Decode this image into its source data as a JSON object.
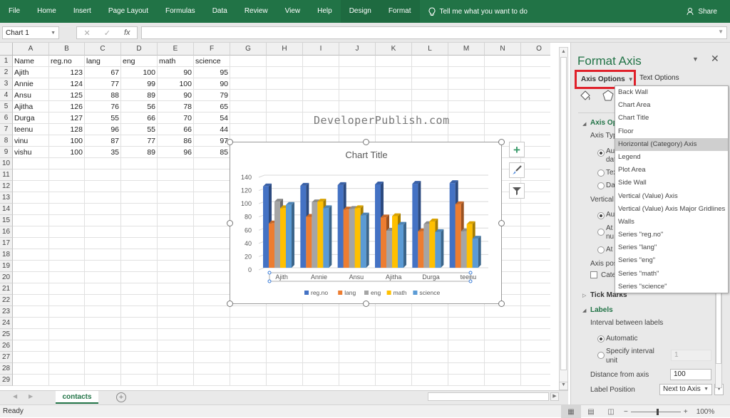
{
  "ribbon": {
    "tabs": [
      "File",
      "Home",
      "Insert",
      "Page Layout",
      "Formulas",
      "Data",
      "Review",
      "View",
      "Help",
      "Design",
      "Format"
    ],
    "tell_me": "Tell me what you want to do",
    "share": "Share",
    "icons": {
      "tell_me": "lightbulb-icon",
      "share": "person-add-icon"
    }
  },
  "formula_bar": {
    "name_box": "Chart 1",
    "cancel": "✕",
    "enter": "✓",
    "fx": "fx",
    "formula": ""
  },
  "sheet": {
    "columns": [
      "A",
      "B",
      "C",
      "D",
      "E",
      "F",
      "G",
      "H",
      "I",
      "J",
      "K",
      "L",
      "M",
      "N",
      "O"
    ],
    "row_numbers": [
      "1",
      "2",
      "3",
      "4",
      "5",
      "6",
      "7",
      "8",
      "9",
      "10",
      "11",
      "12",
      "13",
      "14",
      "15",
      "16",
      "17",
      "18",
      "19",
      "20",
      "21",
      "22",
      "23",
      "24",
      "25",
      "26",
      "27",
      "28",
      "29"
    ],
    "header_row": [
      "Name",
      "reg.no",
      "lang",
      "eng",
      "math",
      "science"
    ],
    "rows": [
      [
        "Ajith",
        "123",
        "67",
        "100",
        "90",
        "95"
      ],
      [
        "Annie",
        "124",
        "77",
        "99",
        "100",
        "90"
      ],
      [
        "Ansu",
        "125",
        "88",
        "89",
        "90",
        "79"
      ],
      [
        "Ajitha",
        "126",
        "76",
        "56",
        "78",
        "65"
      ],
      [
        "Durga",
        "127",
        "55",
        "66",
        "70",
        "54"
      ],
      [
        "teenu",
        "128",
        "96",
        "55",
        "66",
        "44"
      ],
      [
        "vinu",
        "100",
        "87",
        "77",
        "86",
        "97"
      ],
      [
        "vishu",
        "100",
        "35",
        "89",
        "96",
        "85"
      ]
    ],
    "watermark": "DeveloperPublish.com",
    "tab": "contacts",
    "add_sheet": "+"
  },
  "chart_data": {
    "type": "bar",
    "style": "3d-clustered-column",
    "title": "Chart Title",
    "categories": [
      "Ajith",
      "Annie",
      "Ansu",
      "Ajitha",
      "Durga",
      "teenu"
    ],
    "series": [
      {
        "name": "reg.no",
        "color": "#4472c4",
        "values": [
          123,
          124,
          125,
          126,
          127,
          128
        ]
      },
      {
        "name": "lang",
        "color": "#ed7d31",
        "values": [
          67,
          77,
          88,
          76,
          55,
          96
        ]
      },
      {
        "name": "eng",
        "color": "#a5a5a5",
        "values": [
          100,
          99,
          89,
          56,
          66,
          55
        ]
      },
      {
        "name": "math",
        "color": "#ffc000",
        "values": [
          90,
          100,
          90,
          78,
          70,
          66
        ]
      },
      {
        "name": "science",
        "color": "#5b9bd5",
        "values": [
          95,
          90,
          79,
          65,
          54,
          44
        ]
      }
    ],
    "yticks": [
      "0",
      "20",
      "40",
      "60",
      "80",
      "100",
      "120",
      "140"
    ],
    "ylim": [
      0,
      140
    ],
    "xlabel": "",
    "ylabel": "",
    "grid": true,
    "legend": "bottom"
  },
  "chart_buttons": {
    "elements": "+",
    "styles": "brush-icon",
    "filter": "filter-icon"
  },
  "format_pane": {
    "title": "Format Axis",
    "axis_options": "Axis Options",
    "text_options": "Text Options",
    "sections": {
      "axis_options": "Axis Opt",
      "axis_type": "Axis Typ",
      "auto": "Au",
      "auto2": "dat",
      "text": "Tex",
      "date": "Dat",
      "vertical": "Vertical a",
      "v_auto": "Au",
      "v_at1": "At",
      "v_at1b": "nu",
      "v_at2": "At",
      "axis_pos": "Axis pos",
      "categories": "Cate",
      "tick_marks": "Tick Marks",
      "labels": "Labels",
      "interval": "Interval between labels",
      "automatic": "Automatic",
      "specify": "Specify interval",
      "specify2": "unit",
      "specify_value": "1",
      "distance": "Distance from axis",
      "distance_value": "100",
      "label_position": "Label Position",
      "label_position_value": "Next to Axis"
    },
    "dropdown": [
      "Back Wall",
      "Chart Area",
      "Chart Title",
      "Floor",
      "Horizontal (Category) Axis",
      "Legend",
      "Plot Area",
      "Side Wall",
      "Vertical (Value) Axis",
      "Vertical (Value) Axis Major Gridlines",
      "Walls",
      "Series \"reg.no\"",
      "Series \"lang\"",
      "Series \"eng\"",
      "Series \"math\"",
      "Series \"science\""
    ],
    "dropdown_selected": "Horizontal (Category) Axis"
  },
  "status": {
    "ready": "Ready",
    "zoom": "100%",
    "zoom_minus": "−",
    "zoom_plus": "+"
  }
}
